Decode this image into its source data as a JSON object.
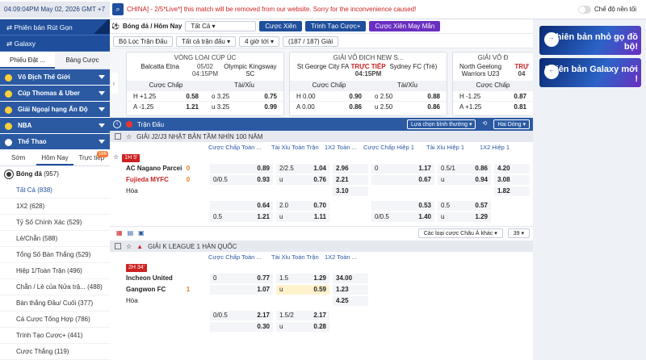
{
  "topbar": {
    "datetime": "04:09:04PM May 02, 2026 GMT +7",
    "search_icon": "search-icon",
    "marquee": "CHINA] - 2/5*Live*] this match will be removed from our website. Sorry for the inconvenience caused!",
    "toggle_label": "Chế độ nền tối"
  },
  "sidebar": {
    "top_items": [
      "Phiên bản Rút Gọn",
      "Galaxy"
    ],
    "tabs": [
      "Phiếu Đặt ...",
      "Bảng Cược"
    ],
    "sections": [
      "Vô Địch Thế Giới",
      "Cúp Thomas & Uber",
      "Giải Ngoại hạng Ấn Độ",
      "NBA",
      "Thể Thao"
    ],
    "sub_tabs": [
      "Sớm",
      "Hôm Nay",
      "Trực tiếp"
    ],
    "live_badge": "186",
    "sport": "Bóng đá",
    "sport_count": "(957)",
    "list": [
      {
        "label": "Tất Cả",
        "count": "(838)"
      },
      {
        "label": "1X2",
        "count": "(628)"
      },
      {
        "label": "Tỷ Số Chính Xác",
        "count": "(529)"
      },
      {
        "label": "Lẻ/Chẵn",
        "count": "(588)"
      },
      {
        "label": "Tổng Số Bàn Thắng",
        "count": "(529)"
      },
      {
        "label": "Hiệp 1/Toàn Trận",
        "count": "(496)"
      },
      {
        "label": "Chẵn / Lẻ của Nửa trậ...",
        "count": "(488)"
      },
      {
        "label": "Bàn thắng Đầu/ Cuối",
        "count": "(377)"
      },
      {
        "label": "Cá Cược Tổng Hợp",
        "count": "(786)"
      },
      {
        "label": "Trình Tạo Cược+",
        "count": "(441)"
      },
      {
        "label": "Cược Thắng",
        "count": "(119)"
      }
    ]
  },
  "filters": {
    "title": "Bóng đá / Hôm Nay",
    "all": "Tất Cả",
    "tabs": [
      "Cược Xiên",
      "Trình Tạo Cược+",
      "Cược Xiên May Mắn"
    ],
    "row2": [
      "Bộ Lọc Trận Đấu",
      "Tất cả trận đấu",
      "4 giờ tới",
      "(187 / 187) Giải"
    ]
  },
  "cards": [
    {
      "league": "VÒNG LOẠI CÚP ÚC",
      "home": "Balcatta Etna",
      "date": "05/02",
      "time": "04:15PM",
      "away": "Olympic Kingsway SC",
      "hdr": [
        "Cược Chấp",
        "Tài/Xỉu"
      ],
      "rows": [
        [
          "H",
          "+1.25",
          "0.58",
          "o",
          "3.25",
          "0.75"
        ],
        [
          "A",
          "-1.25",
          "1.21",
          "u",
          "3.25",
          "0.99"
        ]
      ]
    },
    {
      "league": "GIẢI VÔ ĐỊCH NEW S...",
      "home": "St George City FA",
      "date": "TRỰC TIẾP",
      "time": "04:15PM",
      "away": "Sydney FC (Trẻ)",
      "hdr": [
        "Cược Chấp",
        "Tài/Xỉu"
      ],
      "rows": [
        [
          "H",
          "0.00",
          "0.90",
          "o",
          "2.50",
          "0.88"
        ],
        [
          "A",
          "0.00",
          "0.86",
          "u",
          "2.50",
          "0.86"
        ]
      ]
    },
    {
      "league": "GIẢI VÔ Đ",
      "home": "North Geelong Warriors U23",
      "date": "TRỰ",
      "time": "04",
      "hdr": [
        "Cược Chấp"
      ],
      "rows": [
        [
          "H",
          "-1.25",
          "0.87"
        ],
        [
          "A",
          "+1.25",
          "0.81"
        ]
      ]
    }
  ],
  "strip": {
    "label": "Trận Đấu",
    "sort": "Lựa chọn bình thường",
    "view": "Hai Dòng"
  },
  "league1": {
    "name": "GIẢI J2/J3 NHẬT BẢN TẦM NHÌN 100 NĂM",
    "cols": [
      "Cược Chấp Toàn ...",
      "Tài Xỉu Toàn Trận",
      "1X2 Toàn ...",
      "Cược Chấp Hiệp 1",
      "Tài Xỉu Hiệp 1",
      "1X2 Hiệp 1"
    ],
    "live": "1H 5'",
    "home": "AC Nagano Parceiro",
    "away": "Fujieda MYFC",
    "draw": "Hòa",
    "home_score": "0",
    "away_score": "0",
    "rows": [
      {
        "h1": "",
        "h1o": "0.89",
        "t1": "2/2.5",
        "t1o": "1.04",
        "x": "2.96",
        "hc1": "0",
        "hc1o": "1.17",
        "tx1": "0.5/1",
        "tx1o": "0.86",
        "x1": "4.20"
      },
      {
        "h1": "0/0.5",
        "h1o": "0.93",
        "t1": "u",
        "t1o": "0.76",
        "x": "2.21",
        "hc1": "",
        "hc1o": "0.67",
        "tx1": "u",
        "tx1o": "0.94",
        "x1": "3.08"
      },
      {
        "h1": "",
        "h1o": "",
        "t1": "",
        "t1o": "",
        "x": "3.10",
        "hc1": "",
        "hc1o": "",
        "tx1": "",
        "tx1o": "",
        "x1": "1.82"
      }
    ],
    "extra": [
      {
        "h1": "",
        "h1o": "0.64",
        "t1": "2.0",
        "t1o": "0.70",
        "hc1": "",
        "hc1o": "0.53",
        "tx1": "0.5",
        "tx1o": "0.57"
      },
      {
        "h1": "0.5",
        "h1o": "1.21",
        "t1": "u",
        "t1o": "1.11",
        "hc1": "0/0.5",
        "hc1o": "1.40",
        "tx1": "u",
        "tx1o": "1.29"
      }
    ],
    "footer_select": "Các loại cược Châu Á khác",
    "footer_count": "39"
  },
  "league2": {
    "name": "GIẢI K LEAGUE 1 HÀN QUỐC",
    "cols": [
      "Cược Chấp Toàn ...",
      "Tài Xỉu Toàn Trận",
      "1X2 Toàn ..."
    ],
    "live": "2H 34'",
    "home": "Incheon United",
    "away": "Gangwon FC",
    "draw": "Hòa",
    "home_score": "",
    "away_score": "1",
    "rows": [
      {
        "h": "0",
        "ho": "0.77",
        "t": "1.5",
        "to": "1.29",
        "x": "34.00"
      },
      {
        "h": "",
        "ho": "1.07",
        "t": "u",
        "to": "0.59",
        "x": "1.23"
      },
      {
        "h": "",
        "ho": "",
        "t": "",
        "to": "",
        "x": "4.25"
      }
    ],
    "extra": [
      {
        "h": "0/0.5",
        "ho": "2.17",
        "t": "1.5/2",
        "to": "2.17"
      },
      {
        "h": "",
        "ho": "0.30",
        "t": "u",
        "to": "0.28"
      }
    ]
  },
  "banners": [
    {
      "text": "Phiên bản nhỏ gọ đồ bộ!"
    },
    {
      "text": "Phiên bản Galaxy mới !"
    }
  ]
}
